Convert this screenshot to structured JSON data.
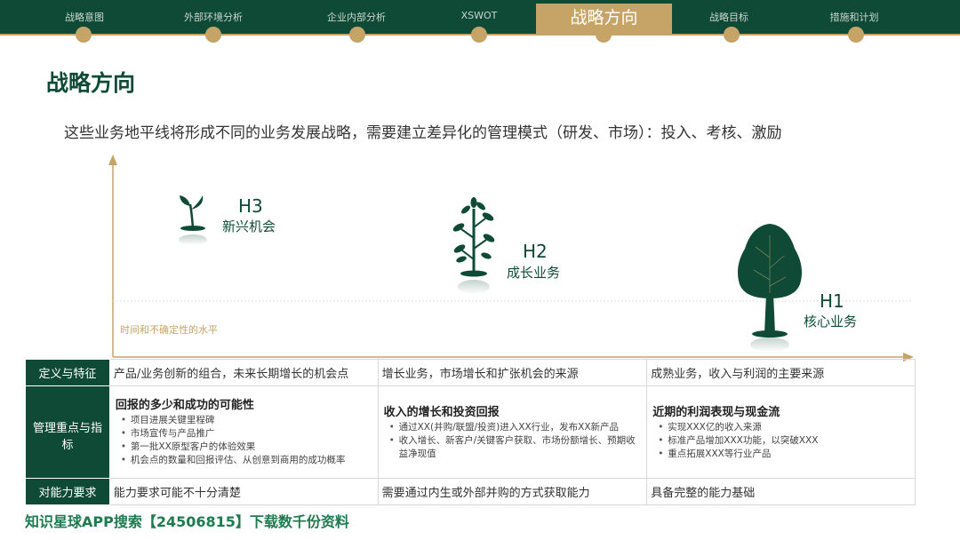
{
  "nav": {
    "items": [
      "战略意图",
      "外部环境分析",
      "企业内部分析",
      "XSWOT",
      "战略目标",
      "措施和计划"
    ],
    "active": "战略方向"
  },
  "page": {
    "title": "战略方向",
    "subtitle": "这些业务地平线将形成不同的业务发展战略，需要建立差异化的管理模式（研发、市场）：投入、考核、激励"
  },
  "diagram": {
    "axis_note": "时间和不确定性的水平",
    "h3": {
      "label": "H3",
      "sub": "新兴机会"
    },
    "h2": {
      "label": "H2",
      "sub": "成长业务"
    },
    "h1": {
      "label": "H1",
      "sub": "核心业务"
    }
  },
  "table": {
    "rows": [
      {
        "head": "定义与特征",
        "cells": [
          "产品/业务创新的组合，未来长期增长的机会点",
          "增长业务，市场增长和扩张机会的来源",
          "成熟业务，收入与利润的主要来源"
        ]
      },
      {
        "head": "管理重点与指标",
        "cells": [
          {
            "title": "回报的多少和成功的可能性",
            "bullets": [
              "项目进展关键里程碑",
              "市场宣传与产品推广",
              "第一批XX原型客户的体验效果",
              "机会点的数量和回报评估、从创意到商用的成功概率"
            ]
          },
          {
            "title": "收入的增长和投资回报",
            "bullets": [
              "通过XX(并购/联盟/投资)进入XX行业，发布XX新产品",
              "收入增长、新客户/关键客户获取、市场份额增长、预期收益净现值"
            ]
          },
          {
            "title": "近期的利润表现与现金流",
            "bullets": [
              "实现XXX亿的收入来源",
              "标准产品增加XXX功能，以突破XXX",
              "重点拓展XXX等行业产品"
            ]
          }
        ]
      },
      {
        "head": "对能力要求",
        "cells": [
          "能力要求可能不十分清楚",
          "需要通过内生或外部并购的方式获取能力",
          "具备完整的能力基础"
        ]
      }
    ]
  },
  "footer": "知识星球APP搜索【24506815】下载数千份资料",
  "colors": {
    "dark_green": "#0f4a37",
    "gold": "#c6a468",
    "footer_green": "#1e7a4f"
  }
}
